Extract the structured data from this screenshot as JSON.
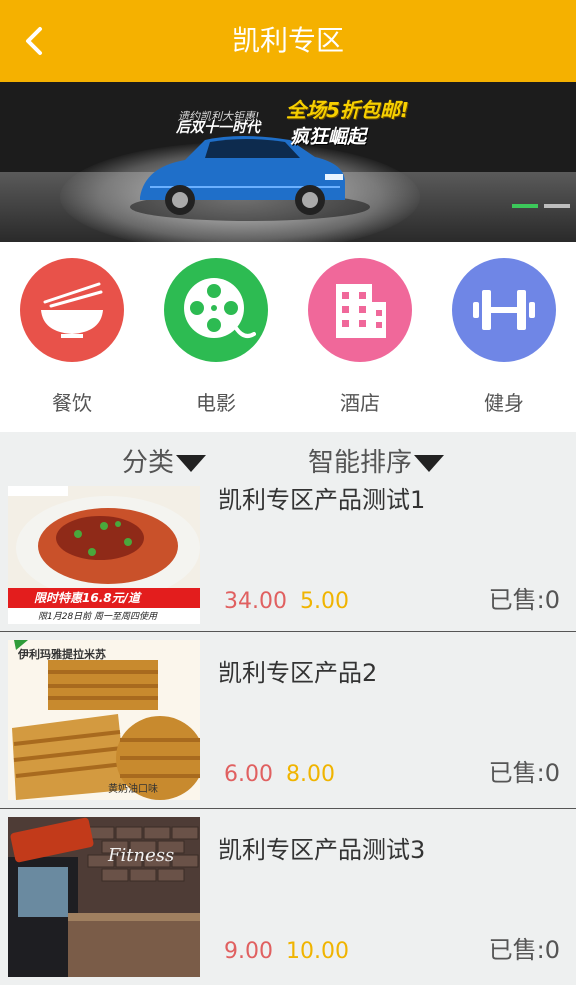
{
  "header": {
    "title": "凯利专区",
    "back_icon": "chevron-left-icon"
  },
  "banner": {
    "small_text": "遗约凯利大钜惠!",
    "sub_text": "后双十一时代",
    "headline": "全场5折包邮!",
    "slogan": "疯狂崛起",
    "slides": 2,
    "active_slide": 1
  },
  "categories": [
    {
      "label": "餐饮",
      "icon": "bowl-icon",
      "color": "#e8524a"
    },
    {
      "label": "电影",
      "icon": "film-reel-icon",
      "color": "#2dbb52"
    },
    {
      "label": "酒店",
      "icon": "building-icon",
      "color": "#f0689a"
    },
    {
      "label": "健身",
      "icon": "dumbbell-icon",
      "color": "#6f86e6"
    }
  ],
  "filters": {
    "category": "分类",
    "sort": "智能排序"
  },
  "products": [
    {
      "name": "凯利专区产品测试1",
      "price": "34.00",
      "original": "5.00",
      "sold": "已售:0",
      "thumb_text": "限时特惠16.8元/道",
      "thumb_sub": "限1月28日前 周一至周四使用"
    },
    {
      "name": "凯利专区产品2",
      "price": "6.00",
      "original": "8.00",
      "sold": "已售:0",
      "thumb_text": "伊利玛雅提拉米苏",
      "thumb_sub": "黄奶油口味"
    },
    {
      "name": "凯利专区产品测试3",
      "price": "9.00",
      "original": "10.00",
      "sold": "已售:0",
      "thumb_text": "Fitness"
    }
  ],
  "colors": {
    "header": "#f5b100",
    "price": "#e06060",
    "original": "#f0b400"
  }
}
